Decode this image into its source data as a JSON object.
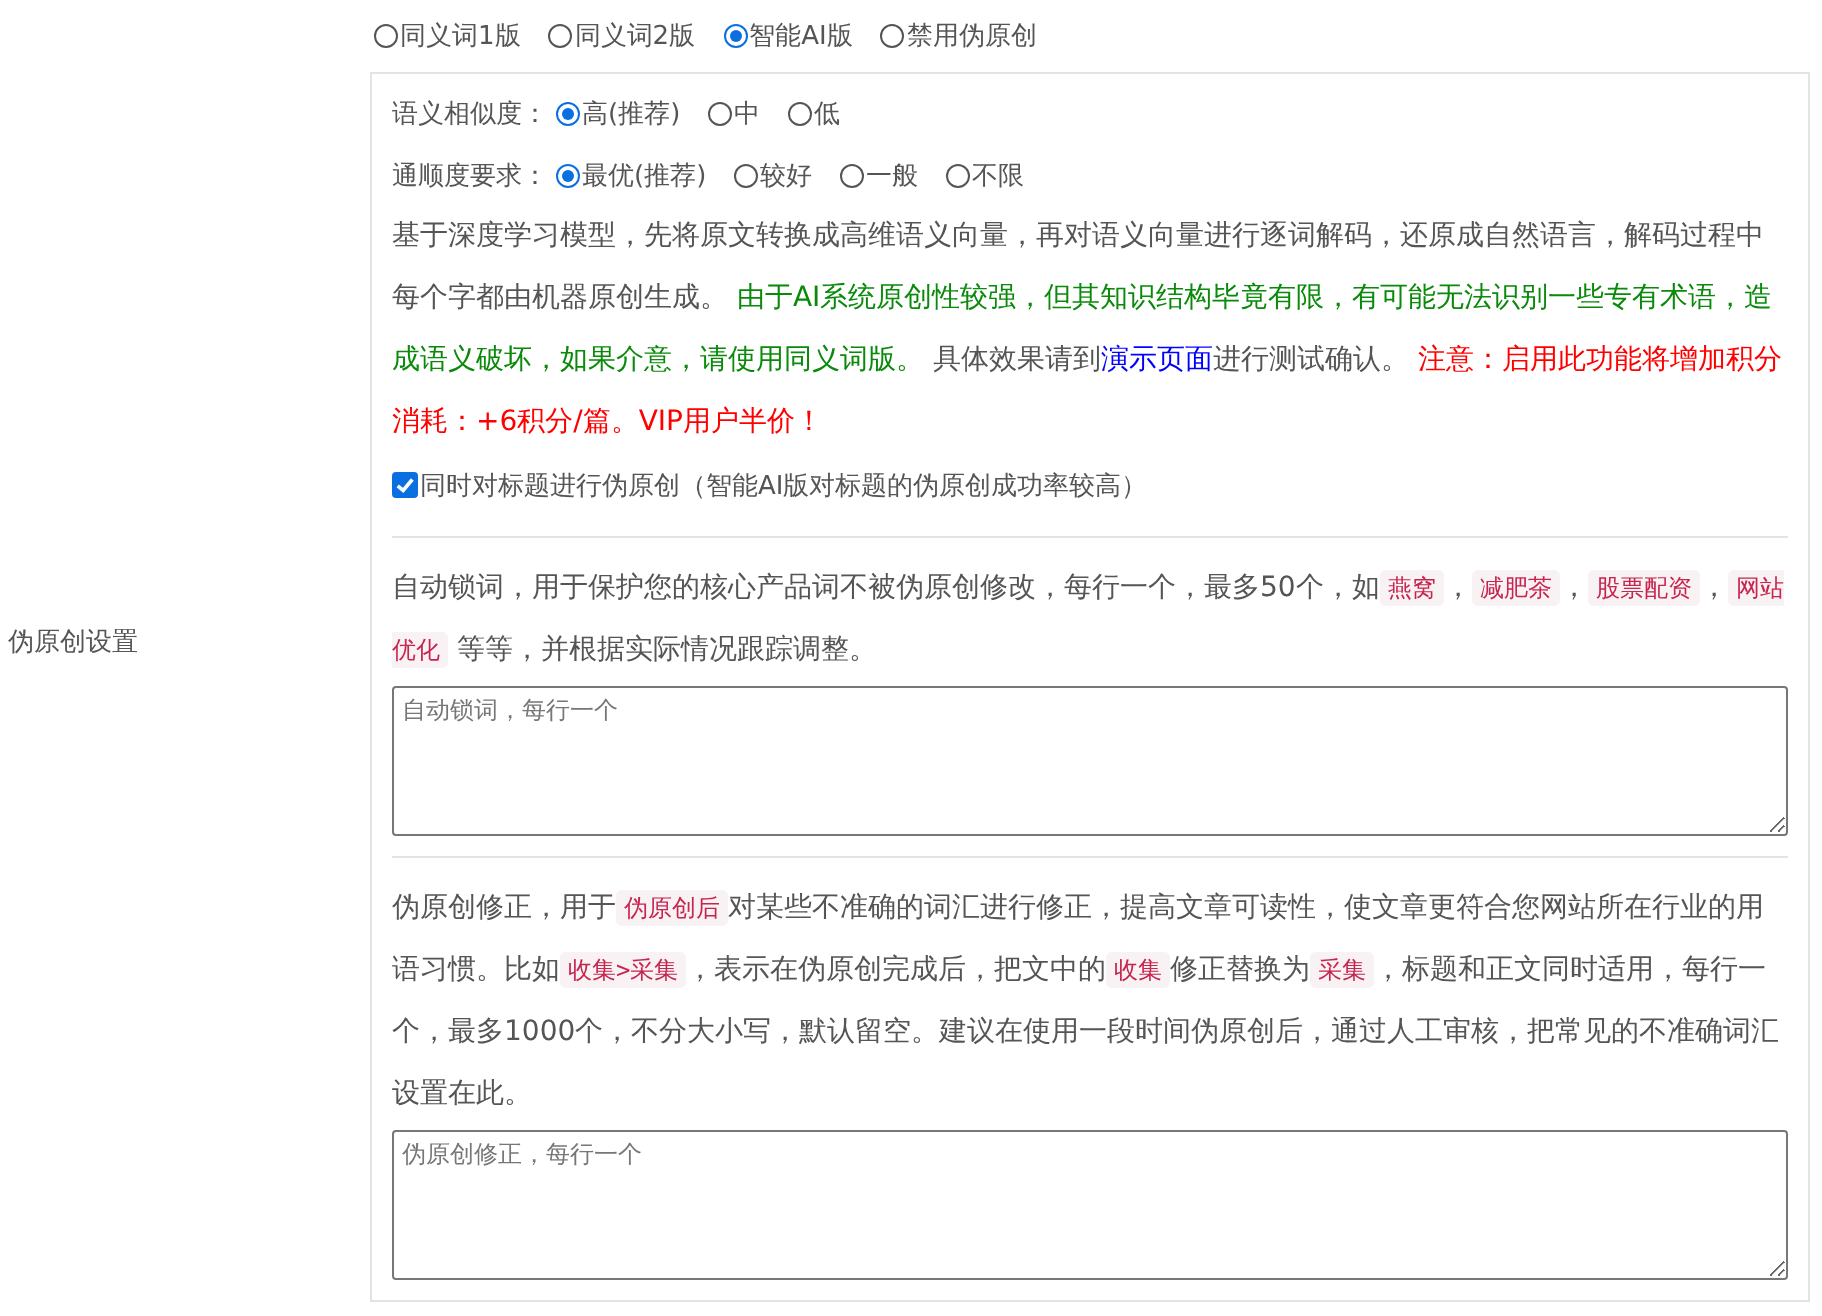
{
  "side_label": "伪原创设置",
  "mode_options": [
    {
      "label": "同义词1版",
      "selected": false
    },
    {
      "label": "同义词2版",
      "selected": false
    },
    {
      "label": "智能AI版",
      "selected": true
    },
    {
      "label": "禁用伪原创",
      "selected": false
    }
  ],
  "similarity": {
    "label": "语义相似度：",
    "options": [
      {
        "label": "高(推荐)",
        "selected": true
      },
      {
        "label": "中",
        "selected": false
      },
      {
        "label": "低",
        "selected": false
      }
    ]
  },
  "fluency": {
    "label": "通顺度要求：",
    "options": [
      {
        "label": "最优(推荐)",
        "selected": true
      },
      {
        "label": "较好",
        "selected": false
      },
      {
        "label": "一般",
        "selected": false
      },
      {
        "label": "不限",
        "selected": false
      }
    ]
  },
  "ai_description": [
    {
      "kind": "plain",
      "text": "基于深度学习模型，先将原文转换成高维语义向量，再对语义向量进行逐词解码，还原成自然语言，解码过程中每个字都由机器原创生成。 "
    },
    {
      "kind": "green",
      "text": "由于AI系统原创性较强，但其知识结构毕竟有限，有可能无法识别一些专有术语，造成语义破坏，如果介意，请使用同义词版。"
    },
    {
      "kind": "plain",
      "text": " 具体效果请到"
    },
    {
      "kind": "link",
      "text": "演示页面"
    },
    {
      "kind": "plain",
      "text": "进行测试确认。 "
    },
    {
      "kind": "red",
      "text": "注意：启用此功能将增加积分消耗：+6积分/篇。VIP用户半价！"
    }
  ],
  "title_option": {
    "label": "同时对标题进行伪原创（智能AI版对标题的伪原创成功率较高）",
    "checked": true
  },
  "lock_description": [
    {
      "kind": "plain",
      "text": "自动锁词，用于保护您的核心产品词不被伪原创修改，每行一个，最多50个，如"
    },
    {
      "kind": "code",
      "text": "燕窝"
    },
    {
      "kind": "plain",
      "text": "，"
    },
    {
      "kind": "code",
      "text": "减肥茶"
    },
    {
      "kind": "plain",
      "text": "，"
    },
    {
      "kind": "code",
      "text": "股票配资"
    },
    {
      "kind": "plain",
      "text": "，"
    },
    {
      "kind": "code",
      "text": "网站优化"
    },
    {
      "kind": "plain",
      "text": " 等等，并根据实际情况跟踪调整。"
    }
  ],
  "lock_field": {
    "placeholder": "自动锁词，每行一个"
  },
  "fix_description": [
    {
      "kind": "plain",
      "text": "伪原创修正，用于"
    },
    {
      "kind": "code",
      "text": "伪原创后"
    },
    {
      "kind": "plain",
      "text": "对某些不准确的词汇进行修正，提高文章可读性，使文章更符合您网站所在行业的用语习惯。比如"
    },
    {
      "kind": "code",
      "text": "收集>采集"
    },
    {
      "kind": "plain",
      "text": "，表示在伪原创完成后，把文中的"
    },
    {
      "kind": "code",
      "text": "收集"
    },
    {
      "kind": "plain",
      "text": "修正替换为"
    },
    {
      "kind": "code",
      "text": "采集"
    },
    {
      "kind": "plain",
      "text": "，标题和正文同时适用，每行一个，最多1000个，不分大小写，默认留空。建议在使用一段时间伪原创后，通过人工审核，把常见的不准确词汇设置在此。"
    }
  ],
  "fix_field": {
    "placeholder": "伪原创修正，每行一个"
  }
}
